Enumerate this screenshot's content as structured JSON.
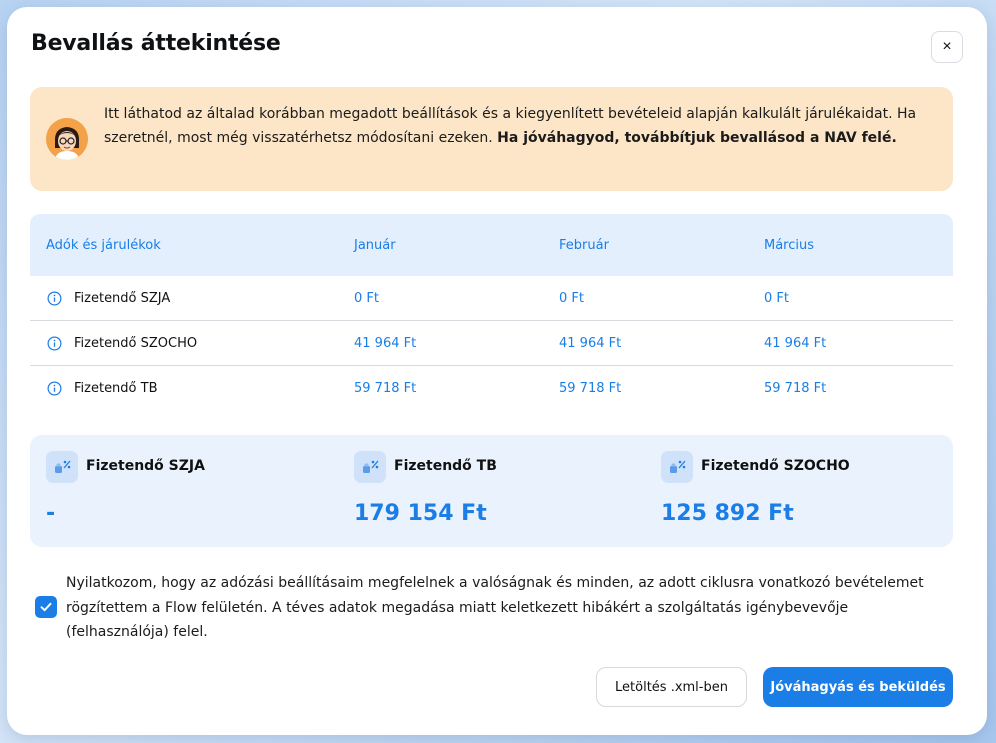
{
  "modal": {
    "title": "Bevallás áttekintése",
    "close_label": "×"
  },
  "notice": {
    "text_plain": "Itt láthatod az általad korábban megadott beállítások és a kiegyenlített bevételeid alapján kalkulált járulékaidat. Ha szeretnél, most még visszatérhetsz módosítani ezeken. ",
    "text_bold": "Ha jóváhagyod, továbbítjuk bevallásod a NAV felé."
  },
  "table": {
    "headers": [
      "Adók és járulékok",
      "Január",
      "Február",
      "Március"
    ],
    "rows": [
      {
        "label": "Fizetendő SZJA",
        "values": [
          "0 Ft",
          "0 Ft",
          "0 Ft"
        ]
      },
      {
        "label": "Fizetendő SZOCHO",
        "values": [
          "41 964 Ft",
          "41 964 Ft",
          "41 964 Ft"
        ]
      },
      {
        "label": "Fizetendő TB",
        "values": [
          "59 718 Ft",
          "59 718 Ft",
          "59 718 Ft"
        ]
      }
    ]
  },
  "summary": [
    {
      "label": "Fizetendő SZJA",
      "value": "-"
    },
    {
      "label": "Fizetendő TB",
      "value": "179 154 Ft"
    },
    {
      "label": "Fizetendő SZOCHO",
      "value": "125 892 Ft"
    }
  ],
  "declaration": {
    "checked": true,
    "text": "Nyilatkozom, hogy az adózási beállításaim megfelelnek a valóságnak és minden, az adott ciklusra vonatkozó bevételemet rögzítettem a Flow felületén. A téves adatok megadása miatt keletkezett hibákért a szolgáltatás igénybevevője (felhasználója) felel."
  },
  "buttons": {
    "download_xml": "Letöltés .xml-ben",
    "approve_submit": "Jóváhagyás és beküldés"
  },
  "colors": {
    "accent": "#1a7ee6",
    "notice_bg": "#fde6c8",
    "table_header_bg": "#e3effd",
    "summary_bg": "#eaf3fd"
  }
}
